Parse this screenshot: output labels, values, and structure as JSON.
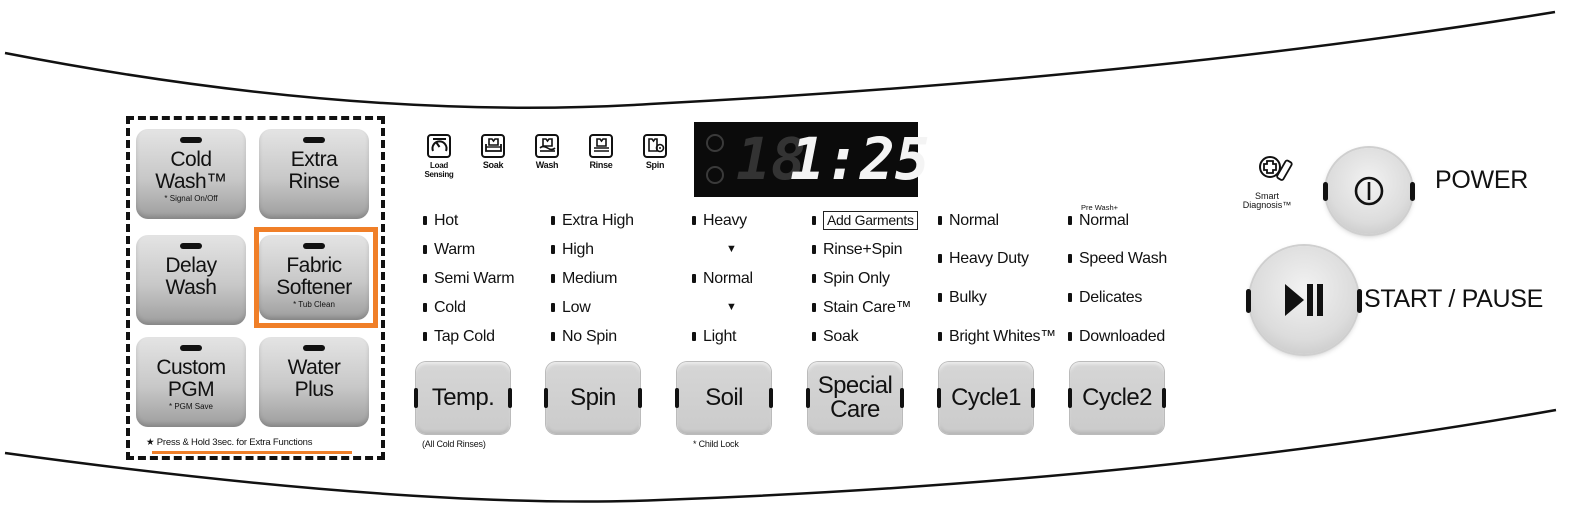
{
  "panel": {
    "accent_color": "#f07f28",
    "option_buttons": [
      {
        "label": "Cold\nWash™",
        "sub": "* Signal On/Off"
      },
      {
        "label": "Extra\nRinse",
        "sub": ""
      },
      {
        "label": "Delay\nWash",
        "sub": ""
      },
      {
        "label": "Fabric\nSoftener",
        "sub": "* Tub Clean"
      },
      {
        "label": "Custom\nPGM",
        "sub": "* PGM Save"
      },
      {
        "label": "Water\nPlus",
        "sub": ""
      }
    ],
    "hold_note": "★ Press & Hold 3sec. for Extra Functions",
    "highlighted_button": "Fabric Softener"
  },
  "stages": [
    {
      "icon": "load-sensing-icon",
      "label": "Load\nSensing"
    },
    {
      "icon": "soak-icon",
      "label": "Soak"
    },
    {
      "icon": "wash-icon",
      "label": "Wash"
    },
    {
      "icon": "rinse-icon",
      "label": "Rinse"
    },
    {
      "icon": "spin-icon",
      "label": "Spin"
    }
  ],
  "display": {
    "dim_digits": "18",
    "time": "1:25"
  },
  "columns": {
    "temp": [
      "Hot",
      "Warm",
      "Semi Warm",
      "Cold",
      "Tap Cold"
    ],
    "spin": [
      "Extra High",
      "High",
      "Medium",
      "Low",
      "No Spin"
    ],
    "soil": [
      "Heavy",
      "▼",
      "Normal",
      "▼",
      "Light"
    ],
    "special": [
      "Add Garments",
      "Rinse+Spin",
      "Spin Only",
      "Stain Care™",
      "Soak"
    ],
    "cycle1": [
      "Normal",
      "Heavy Duty",
      "Bulky",
      "Bright Whites™"
    ],
    "cycle2_note": "Pre Wash+",
    "cycle2": [
      "Normal",
      "Speed Wash",
      "Delicates",
      "Downloaded"
    ]
  },
  "main_buttons": [
    {
      "label": "Temp.",
      "note": "(All Cold Rinses)"
    },
    {
      "label": "Spin",
      "note": ""
    },
    {
      "label": "Soil",
      "note": "* Child Lock"
    },
    {
      "label": "Special\nCare",
      "note": ""
    },
    {
      "label": "Cycle1",
      "note": ""
    },
    {
      "label": "Cycle2",
      "note": ""
    }
  ],
  "right": {
    "smart_diagnosis": "Smart\nDiagnosis™",
    "power_label": "POWER",
    "start_label": "START / PAUSE"
  }
}
